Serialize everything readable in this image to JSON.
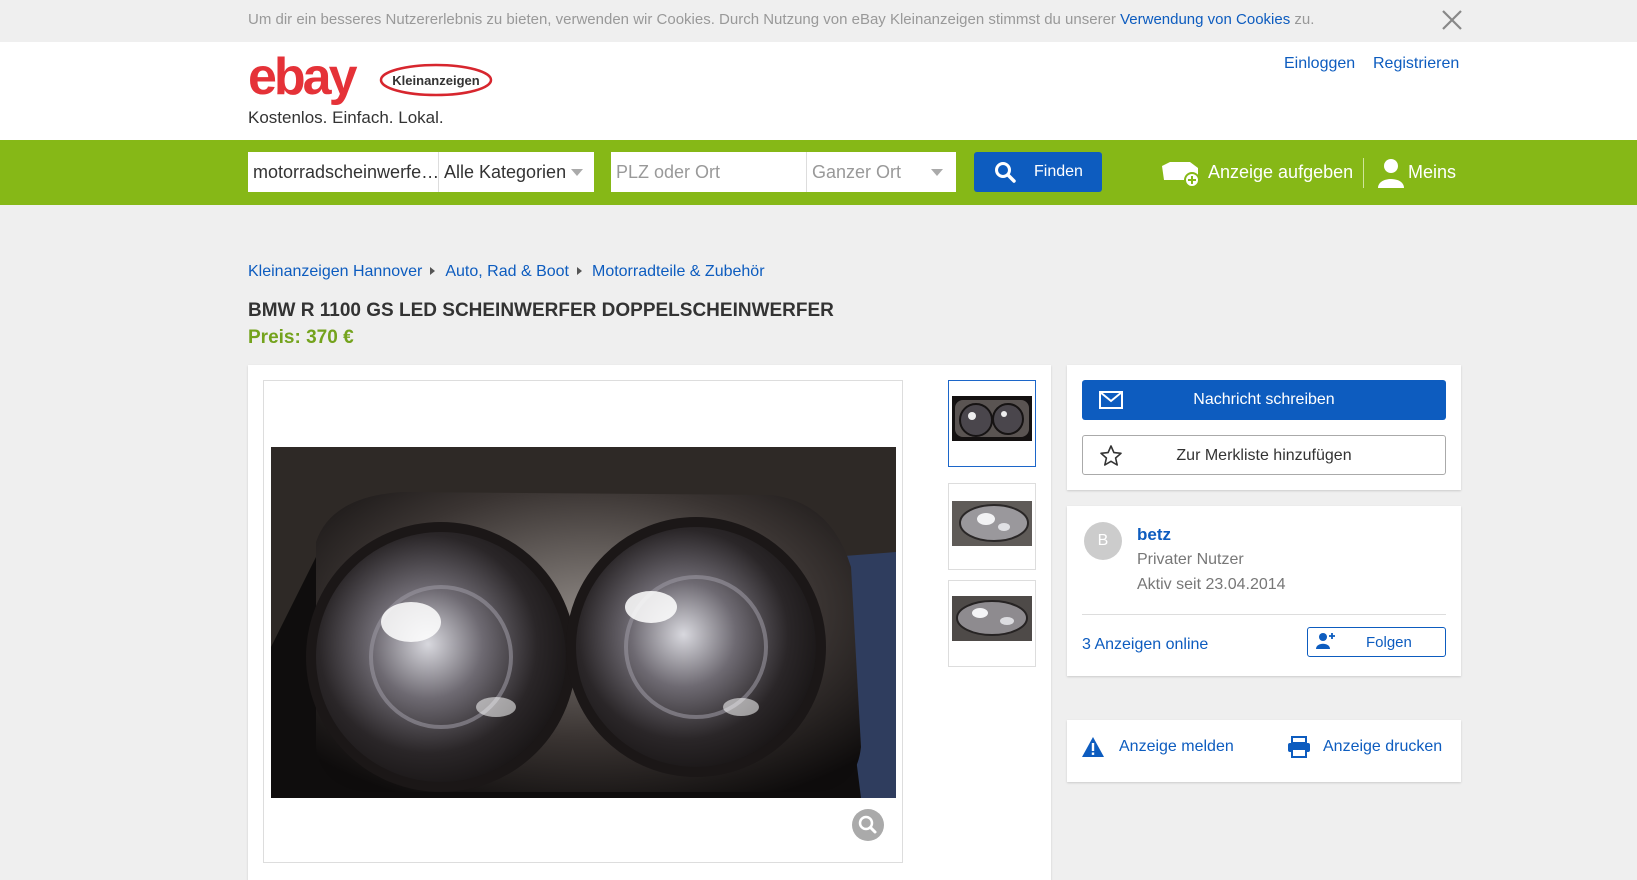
{
  "cookie": {
    "text": "Um dir ein besseres Nutzererlebnis zu bieten, verwenden wir Cookies. Durch Nutzung von eBay Kleinanzeigen stimmst du unserer ",
    "link": "Verwendung von Cookies",
    "suffix": " zu."
  },
  "header": {
    "logo_text": "ebay",
    "logo_badge": "Kleinanzeigen",
    "tagline": "Kostenlos. Einfach. Lokal.",
    "login": "Einloggen",
    "register": "Registrieren"
  },
  "search": {
    "query": "motorradscheinwerfe…",
    "category": "Alle Kategorien",
    "location_placeholder": "PLZ oder Ort",
    "radius": "Ganzer Ort",
    "find_label": "Finden",
    "post_ad": "Anzeige aufgeben",
    "my_account": "Meins"
  },
  "breadcrumb": [
    "Kleinanzeigen Hannover",
    "Auto, Rad & Boot",
    "Motorradteile & Zubehör"
  ],
  "listing": {
    "title": "BMW R 1100 GS LED SCHEINWERFER DOPPELSCHEINWERFER",
    "price": "Preis: 370 €"
  },
  "contact": {
    "message_label": "Nachricht schreiben",
    "watchlist_label": "Zur Merkliste hinzufügen"
  },
  "seller": {
    "initial": "B",
    "name": "betz",
    "type": "Privater Nutzer",
    "since": "Aktiv seit 23.04.2014",
    "ads_online": "3 Anzeigen online",
    "follow_label": "Folgen"
  },
  "actions": {
    "report": "Anzeige melden",
    "print": "Anzeige drucken"
  },
  "colors": {
    "brand_green": "#86b817",
    "link_blue": "#0d5cbf",
    "price_green": "#74a31d"
  }
}
